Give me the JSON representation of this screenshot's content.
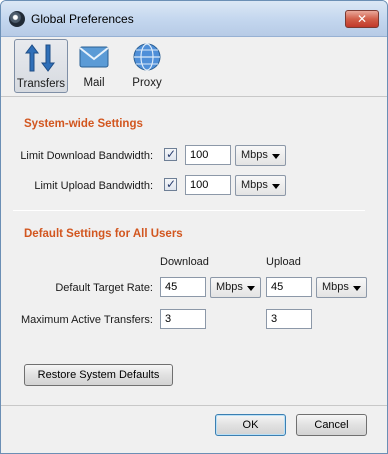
{
  "window": {
    "title": "Global Preferences",
    "close_glyph": "✕"
  },
  "toolbar": {
    "tabs": [
      {
        "label": "Transfers",
        "icon": "transfers-arrows-icon",
        "selected": true
      },
      {
        "label": "Mail",
        "icon": "mail-envelope-icon",
        "selected": false
      },
      {
        "label": "Proxy",
        "icon": "proxy-globe-icon",
        "selected": false
      }
    ]
  },
  "system_wide": {
    "title": "System-wide Settings",
    "download": {
      "label": "Limit Download Bandwidth:",
      "checked": true,
      "value": "100",
      "unit": "Mbps"
    },
    "upload": {
      "label": "Limit Upload Bandwidth:",
      "checked": true,
      "value": "100",
      "unit": "Mbps"
    }
  },
  "default_users": {
    "title": "Default Settings for All Users",
    "col_download": "Download",
    "col_upload": "Upload",
    "target_rate": {
      "label": "Default Target Rate:",
      "download_value": "45",
      "download_unit": "Mbps",
      "upload_value": "45",
      "upload_unit": "Mbps"
    },
    "max_transfers": {
      "label": "Maximum Active Transfers:",
      "download_value": "3",
      "upload_value": "3"
    }
  },
  "buttons": {
    "restore": "Restore System Defaults",
    "ok": "OK",
    "cancel": "Cancel"
  },
  "colors": {
    "section_title": "#d2561f",
    "titlebar": "#c3d6ee",
    "close_button": "#c0392b"
  }
}
